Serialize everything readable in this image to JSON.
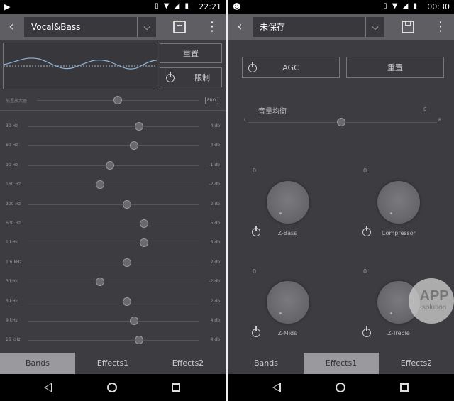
{
  "left": {
    "status_time": "22:21",
    "preset": "Vocal&Bass",
    "reset_label": "重置",
    "limit_label": "限制",
    "preamp_label": "前置放大器",
    "pro_badge": "PRO",
    "bands": [
      {
        "freq": "30 Hz",
        "value": "4 db",
        "level": 0.65
      },
      {
        "freq": "60 Hz",
        "value": "4 db",
        "level": 0.62
      },
      {
        "freq": "90 Hz",
        "value": "-1 db",
        "level": 0.48
      },
      {
        "freq": "160 Hz",
        "value": "-2 db",
        "level": 0.42
      },
      {
        "freq": "300 Hz",
        "value": "2 db",
        "level": 0.58
      },
      {
        "freq": "600 Hz",
        "value": "5 db",
        "level": 0.68
      },
      {
        "freq": "1 kHz",
        "value": "5 db",
        "level": 0.68
      },
      {
        "freq": "1.6 kHz",
        "value": "2 db",
        "level": 0.58
      },
      {
        "freq": "3 kHz",
        "value": "-2 db",
        "level": 0.42
      },
      {
        "freq": "5 kHz",
        "value": "2 db",
        "level": 0.58
      },
      {
        "freq": "9 kHz",
        "value": "4 db",
        "level": 0.62
      },
      {
        "freq": "16 kHz",
        "value": "4 db",
        "level": 0.65
      }
    ],
    "tabs": [
      "Bands",
      "Effects1",
      "Effects2"
    ],
    "active_tab": 0
  },
  "right": {
    "status_time": "00:30",
    "preset": "未保存",
    "agc_label": "AGC",
    "reset_label": "重置",
    "balance_label": "音量均衡",
    "balance_value": "0",
    "balance_left": "L",
    "balance_right": "R",
    "knobs": [
      {
        "label": "Z-Bass",
        "value": "0"
      },
      {
        "label": "Compressor",
        "value": "0"
      },
      {
        "label": "Z-Mids",
        "value": "0"
      },
      {
        "label": "Z-Treble",
        "value": "0"
      }
    ],
    "tabs": [
      "Bands",
      "Effects1",
      "Effects2"
    ],
    "active_tab": 1,
    "watermark_line1": "APP",
    "watermark_line2": "solution"
  }
}
